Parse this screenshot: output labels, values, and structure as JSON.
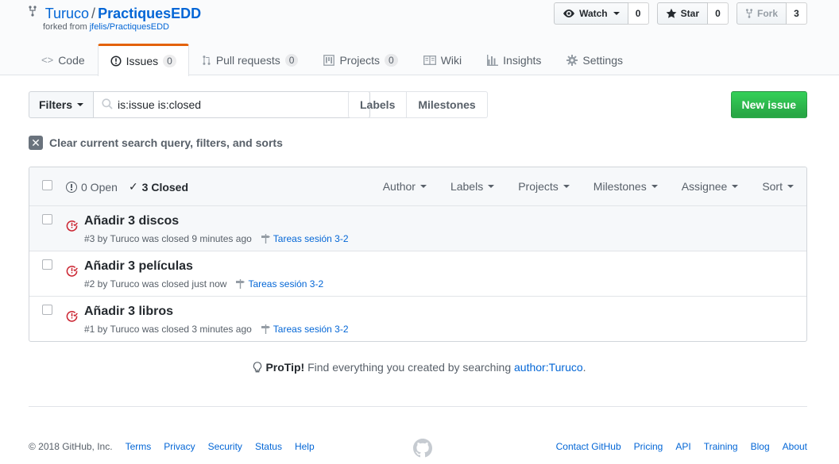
{
  "repo": {
    "owner": "Turuco",
    "separator": "/",
    "name": "PractiquesEDD",
    "forked_prefix": "forked from",
    "forked_from": "jfelis/PractiquesEDD"
  },
  "actions": {
    "watch": {
      "label": "Watch",
      "count": "0"
    },
    "star": {
      "label": "Star",
      "count": "0"
    },
    "fork": {
      "label": "Fork",
      "count": "3"
    }
  },
  "nav": [
    {
      "label": "Code",
      "counter": null
    },
    {
      "label": "Issues",
      "counter": "0"
    },
    {
      "label": "Pull requests",
      "counter": "0"
    },
    {
      "label": "Projects",
      "counter": "0"
    },
    {
      "label": "Wiki",
      "counter": null
    },
    {
      "label": "Insights",
      "counter": null
    },
    {
      "label": "Settings",
      "counter": null
    }
  ],
  "subnav": {
    "filters_label": "Filters",
    "search_value": "is:issue is:closed",
    "labels": "Labels",
    "milestones": "Milestones",
    "new_issue": "New issue"
  },
  "clear_query": "Clear current search query, filters, and sorts",
  "states": {
    "open": "0 Open",
    "closed": "3 Closed"
  },
  "table_filters": [
    "Author",
    "Labels",
    "Projects",
    "Milestones",
    "Assignee",
    "Sort"
  ],
  "issues": [
    {
      "title": "Añadir 3 discos",
      "meta": "#3 by Turuco was closed 9 minutes ago",
      "milestone": "Tareas sesión 3-2"
    },
    {
      "title": "Añadir 3 películas",
      "meta": "#2 by Turuco was closed just now",
      "milestone": "Tareas sesión 3-2"
    },
    {
      "title": "Añadir 3 libros",
      "meta": "#1 by Turuco was closed 3 minutes ago",
      "milestone": "Tareas sesión 3-2"
    }
  ],
  "protip": {
    "label": "ProTip!",
    "text": " Find everything you created by searching ",
    "link": "author:Turuco",
    "end": "."
  },
  "footer": {
    "copyright": "© 2018 GitHub, Inc.",
    "left_links": [
      "Terms",
      "Privacy",
      "Security",
      "Status",
      "Help"
    ],
    "right_links": [
      "Contact GitHub",
      "Pricing",
      "API",
      "Training",
      "Blog",
      "About"
    ]
  },
  "colors": {
    "accent": "#0366d6",
    "green": "#28a745",
    "closed_red": "#cb2431",
    "nav_selected": "#e36209"
  },
  "icons": {
    "fork": "repo-forked-icon",
    "watch": "eye-icon",
    "star": "star-icon",
    "closed": "issue-closed-icon",
    "milestone": "milestone-icon"
  }
}
